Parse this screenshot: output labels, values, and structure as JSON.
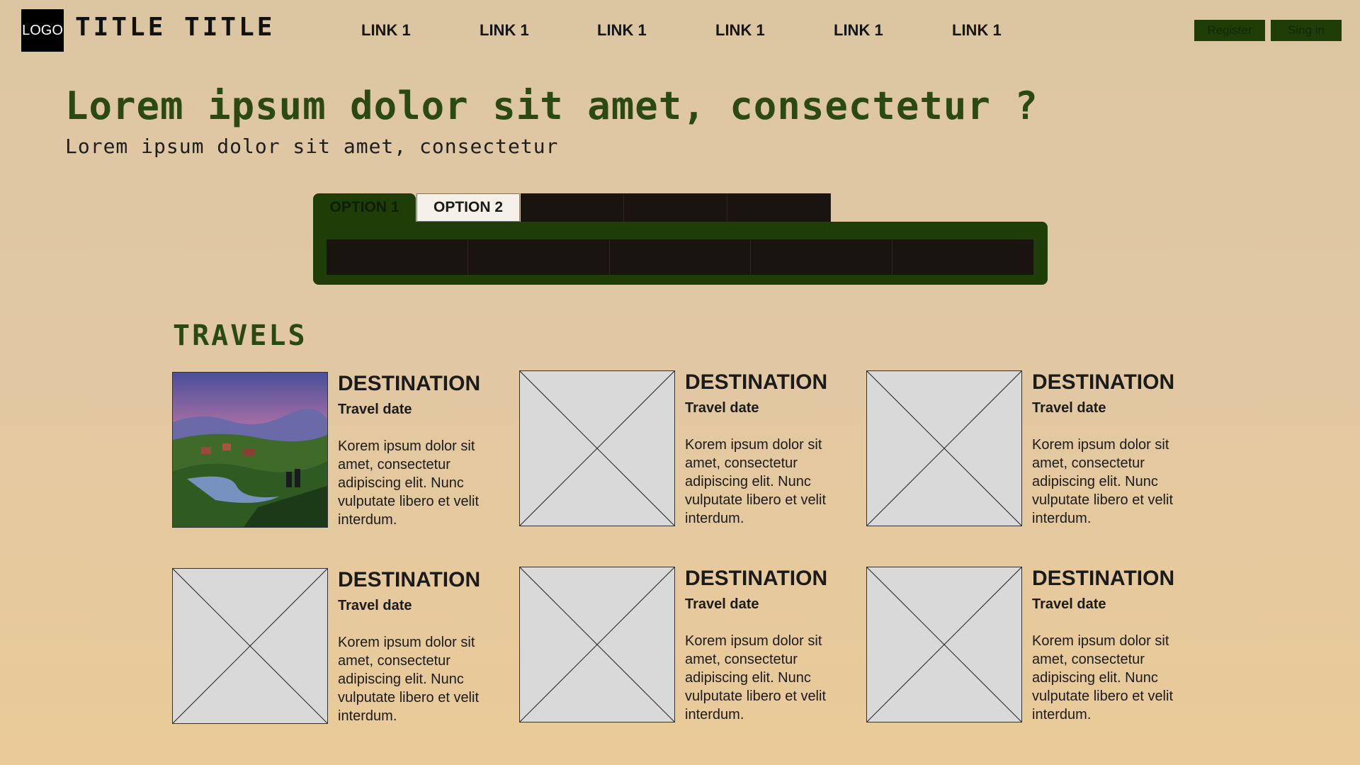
{
  "header": {
    "logo": "LOGO",
    "title": "TITLE TITLE",
    "nav": [
      "LINK 1",
      "LINK 1",
      "LINK 1",
      "LINK 1",
      "LINK 1",
      "LINK 1"
    ],
    "register": "Register",
    "signin": "Sing in"
  },
  "hero": {
    "title": "Lorem ipsum dolor sit amet, consectetur ?",
    "subtitle": "Lorem ipsum dolor sit amet, consectetur"
  },
  "search": {
    "tabs": [
      "OPTION 1",
      "OPTION 2"
    ]
  },
  "travels": {
    "title": "TRAVELS",
    "cards": [
      {
        "destination": "DESTINATION",
        "date": "Travel date",
        "description": "Korem ipsum dolor sit amet, consectetur adipiscing elit. Nunc vulputate libero et velit interdum.",
        "image": "landscape-painting"
      },
      {
        "destination": "DESTINATION",
        "date": "Travel date",
        "description": "Korem ipsum dolor sit amet, consectetur adipiscing elit. Nunc vulputate libero et velit interdum.",
        "image": "placeholder"
      },
      {
        "destination": "DESTINATION",
        "date": "Travel date",
        "description": "Korem ipsum dolor sit amet, consectetur adipiscing elit. Nunc vulputate libero et velit interdum.",
        "image": "placeholder"
      },
      {
        "destination": "DESTINATION",
        "date": "Travel date",
        "description": "Korem ipsum dolor sit amet, consectetur adipiscing elit. Nunc vulputate libero et velit interdum.",
        "image": "placeholder"
      },
      {
        "destination": "DESTINATION",
        "date": "Travel date",
        "description": "Korem ipsum dolor sit amet, consectetur adipiscing elit. Nunc vulputate libero et velit interdum.",
        "image": "placeholder"
      },
      {
        "destination": "DESTINATION",
        "date": "Travel date",
        "description": "Korem ipsum dolor sit amet, consectetur adipiscing elit. Nunc vulputate libero et velit interdum.",
        "image": "placeholder"
      }
    ]
  },
  "colors": {
    "accent": "#1f3d06",
    "title_green": "#2b4a13",
    "dark": "#1a1411",
    "background": "#e1c8a3"
  }
}
